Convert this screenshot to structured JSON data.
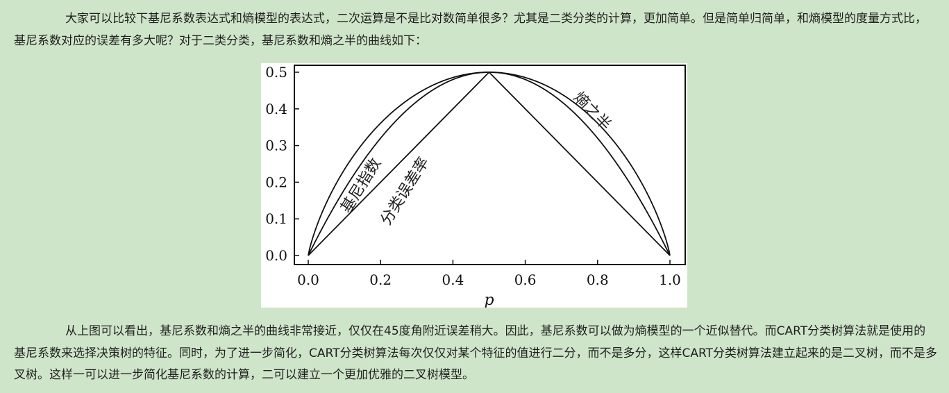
{
  "paragraph_1": "大家可以比较下基尼系数表达式和熵模型的表达式，二次运算是不是比对数简单很多？尤其是二类分类的计算，更加简单。但是简单归简单，和熵模型的度量方式比，基尼系数对应的误差有多大呢？对于二类分类，基尼系数和熵之半的曲线如下：",
  "paragraph_2": "从上图可以看出，基尼系数和熵之半的曲线非常接近，仅仅在45度角附近误差稍大。因此，基尼系数可以做为熵模型的一个近似替代。而CART分类树算法就是使用的基尼系数来选择决策树的特征。同时，为了进一步简化，CART分类树算法每次仅仅对某个特征的值进行二分，而不是多分，这样CART分类树算法建立起来的是二叉树，而不是多叉树。这样一可以进一步简化基尼系数的计算，二可以建立一个更加优雅的二叉树模型。",
  "chart_data": {
    "type": "line",
    "xlabel": "p",
    "ylabel": "",
    "xlim": [
      0.0,
      1.0
    ],
    "ylim": [
      0.0,
      0.5
    ],
    "x_ticks": [
      "0.0",
      "0.2",
      "0.4",
      "0.6",
      "0.8",
      "1.0"
    ],
    "y_ticks": [
      "0.0",
      "0.1",
      "0.2",
      "0.3",
      "0.4",
      "0.5"
    ],
    "grid": false,
    "series": [
      {
        "name": "熵之半",
        "x": [
          0.0,
          0.05,
          0.1,
          0.2,
          0.3,
          0.4,
          0.5,
          0.6,
          0.7,
          0.8,
          0.9,
          0.95,
          1.0
        ],
        "y": [
          0.0,
          0.143,
          0.234,
          0.361,
          0.441,
          0.485,
          0.5,
          0.485,
          0.441,
          0.361,
          0.234,
          0.143,
          0.0
        ]
      },
      {
        "name": "基尼指数",
        "x": [
          0.0,
          0.05,
          0.1,
          0.2,
          0.3,
          0.4,
          0.5,
          0.6,
          0.7,
          0.8,
          0.9,
          0.95,
          1.0
        ],
        "y": [
          0.0,
          0.095,
          0.18,
          0.32,
          0.42,
          0.48,
          0.5,
          0.48,
          0.42,
          0.32,
          0.18,
          0.095,
          0.0
        ]
      },
      {
        "name": "分类误差率",
        "x": [
          0.0,
          0.5,
          1.0
        ],
        "y": [
          0.0,
          0.5,
          0.0
        ]
      }
    ]
  }
}
